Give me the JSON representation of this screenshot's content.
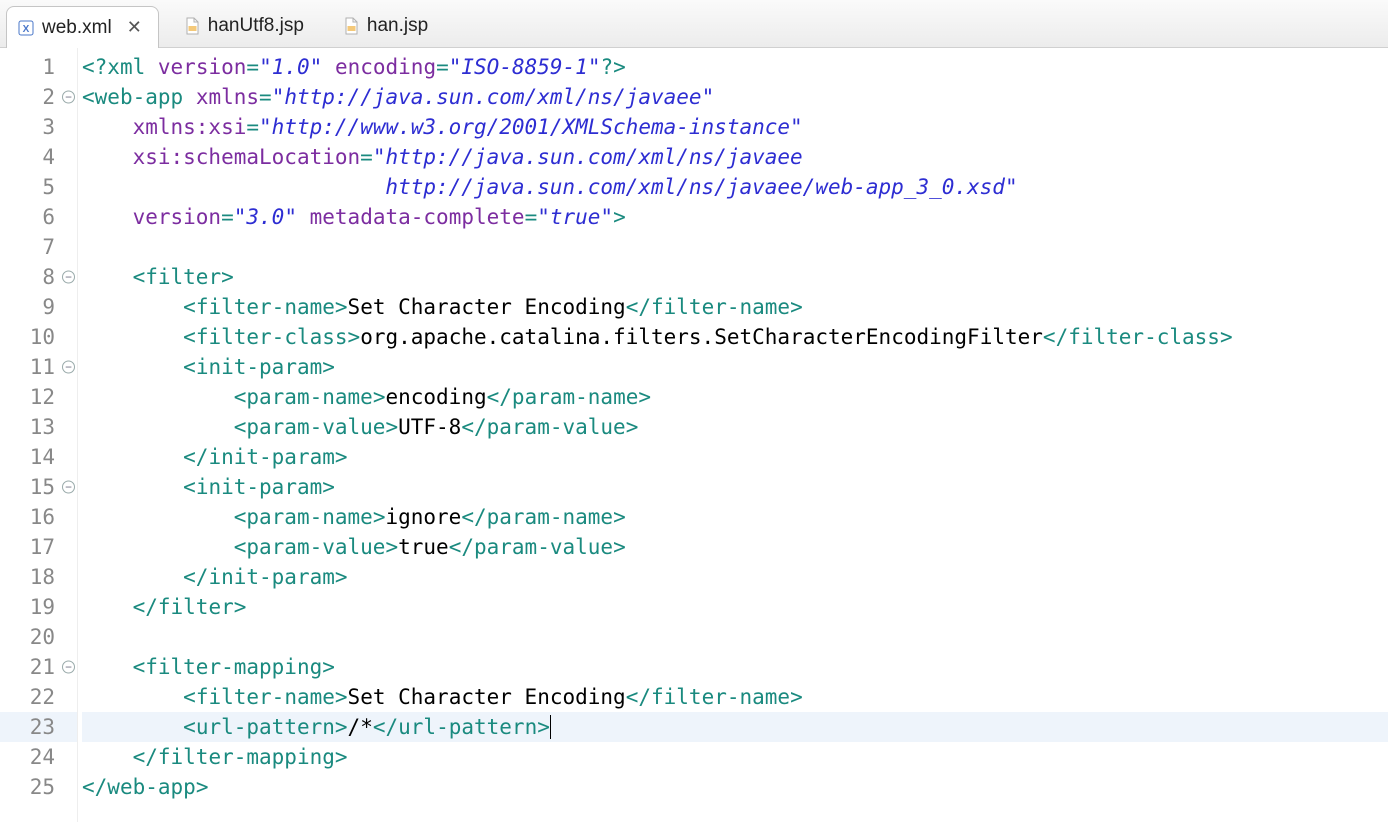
{
  "tabs": [
    {
      "label": "web.xml",
      "icon": "xml-file-icon",
      "active": true,
      "closeGlyph": "✕"
    },
    {
      "label": "hanUtf8.jsp",
      "icon": "jsp-file-icon",
      "active": false
    },
    {
      "label": "han.jsp",
      "icon": "jsp-file-icon",
      "active": false
    }
  ],
  "gutter": {
    "foldLines": [
      2,
      8,
      11,
      15,
      21
    ],
    "foldGlyph": "−",
    "currentLine": 23,
    "total": 25
  },
  "code": {
    "lines": [
      {
        "n": 1,
        "html": "<span class='c-pi'>&lt;?</span><span class='c-piname'>xml</span> <span class='c-attr'>version</span><span class='c-punct'>=</span><span class='c-str'>\"1.0\"</span> <span class='c-attr'>encoding</span><span class='c-punct'>=</span><span class='c-str'>\"ISO-8859-1\"</span><span class='c-pi'>?&gt;</span>"
      },
      {
        "n": 2,
        "html": "<span class='c-punct'>&lt;</span><span class='c-tag'>web-app</span> <span class='c-attr'>xmlns</span><span class='c-punct'>=</span><span class='c-str'>\"http://java.sun.com/xml/ns/javaee\"</span>"
      },
      {
        "n": 3,
        "html": "    <span class='c-attr'>xmlns:xsi</span><span class='c-punct'>=</span><span class='c-str'>\"http://www.w3.org/2001/XMLSchema-instance\"</span>"
      },
      {
        "n": 4,
        "html": "    <span class='c-attr'>xsi:schemaLocation</span><span class='c-punct'>=</span><span class='c-str'>\"http://java.sun.com/xml/ns/javaee</span>"
      },
      {
        "n": 5,
        "html": "<span class='c-str'>                        http://java.sun.com/xml/ns/javaee/web-app_3_0.xsd\"</span>"
      },
      {
        "n": 6,
        "html": "    <span class='c-attr'>version</span><span class='c-punct'>=</span><span class='c-str'>\"3.0\"</span> <span class='c-attr'>metadata-complete</span><span class='c-punct'>=</span><span class='c-str'>\"true\"</span><span class='c-punct'>&gt;</span>"
      },
      {
        "n": 7,
        "html": ""
      },
      {
        "n": 8,
        "html": "    <span class='c-punct'>&lt;</span><span class='c-tag'>filter</span><span class='c-punct'>&gt;</span>"
      },
      {
        "n": 9,
        "html": "        <span class='c-punct'>&lt;</span><span class='c-tag'>filter-name</span><span class='c-punct'>&gt;</span><span class='c-text'>Set Character Encoding</span><span class='c-punct'>&lt;/</span><span class='c-tag'>filter-name</span><span class='c-punct'>&gt;</span>"
      },
      {
        "n": 10,
        "html": "        <span class='c-punct'>&lt;</span><span class='c-tag'>filter-class</span><span class='c-punct'>&gt;</span><span class='c-text'>org.apache.catalina.filters.SetCharacterEncodingFilter</span><span class='c-punct'>&lt;/</span><span class='c-tag'>filter-class</span><span class='c-punct'>&gt;</span>"
      },
      {
        "n": 11,
        "html": "        <span class='c-punct'>&lt;</span><span class='c-tag'>init-param</span><span class='c-punct'>&gt;</span>"
      },
      {
        "n": 12,
        "html": "            <span class='c-punct'>&lt;</span><span class='c-tag'>param-name</span><span class='c-punct'>&gt;</span><span class='c-text'>encoding</span><span class='c-punct'>&lt;/</span><span class='c-tag'>param-name</span><span class='c-punct'>&gt;</span>"
      },
      {
        "n": 13,
        "html": "            <span class='c-punct'>&lt;</span><span class='c-tag'>param-value</span><span class='c-punct'>&gt;</span><span class='c-text'>UTF-8</span><span class='c-punct'>&lt;/</span><span class='c-tag'>param-value</span><span class='c-punct'>&gt;</span>"
      },
      {
        "n": 14,
        "html": "        <span class='c-punct'>&lt;/</span><span class='c-tag'>init-param</span><span class='c-punct'>&gt;</span>"
      },
      {
        "n": 15,
        "html": "        <span class='c-punct'>&lt;</span><span class='c-tag'>init-param</span><span class='c-punct'>&gt;</span>"
      },
      {
        "n": 16,
        "html": "            <span class='c-punct'>&lt;</span><span class='c-tag'>param-name</span><span class='c-punct'>&gt;</span><span class='c-text'>ignore</span><span class='c-punct'>&lt;/</span><span class='c-tag'>param-name</span><span class='c-punct'>&gt;</span>"
      },
      {
        "n": 17,
        "html": "            <span class='c-punct'>&lt;</span><span class='c-tag'>param-value</span><span class='c-punct'>&gt;</span><span class='c-text'>true</span><span class='c-punct'>&lt;/</span><span class='c-tag'>param-value</span><span class='c-punct'>&gt;</span>"
      },
      {
        "n": 18,
        "html": "        <span class='c-punct'>&lt;/</span><span class='c-tag'>init-param</span><span class='c-punct'>&gt;</span>"
      },
      {
        "n": 19,
        "html": "    <span class='c-punct'>&lt;/</span><span class='c-tag'>filter</span><span class='c-punct'>&gt;</span>"
      },
      {
        "n": 20,
        "html": ""
      },
      {
        "n": 21,
        "html": "    <span class='c-punct'>&lt;</span><span class='c-tag'>filter-mapping</span><span class='c-punct'>&gt;</span>"
      },
      {
        "n": 22,
        "html": "        <span class='c-punct'>&lt;</span><span class='c-tag'>filter-name</span><span class='c-punct'>&gt;</span><span class='c-text'>Set Character Encoding</span><span class='c-punct'>&lt;/</span><span class='c-tag'>filter-name</span><span class='c-punct'>&gt;</span>"
      },
      {
        "n": 23,
        "html": "        <span class='c-punct'>&lt;</span><span class='c-tag'>url-pattern</span><span class='c-punct'>&gt;</span><span class='c-text'>/*</span><span class='c-punct'>&lt;/</span><span class='c-tag'>url-pattern</span><span class='c-punct'>&gt;</span><span class='caret'></span>"
      },
      {
        "n": 24,
        "html": "    <span class='c-punct'>&lt;/</span><span class='c-tag'>filter-mapping</span><span class='c-punct'>&gt;</span>"
      },
      {
        "n": 25,
        "html": "<span class='c-punct'>&lt;/</span><span class='c-tag'>web-app</span><span class='c-punct'>&gt;</span>"
      }
    ]
  }
}
